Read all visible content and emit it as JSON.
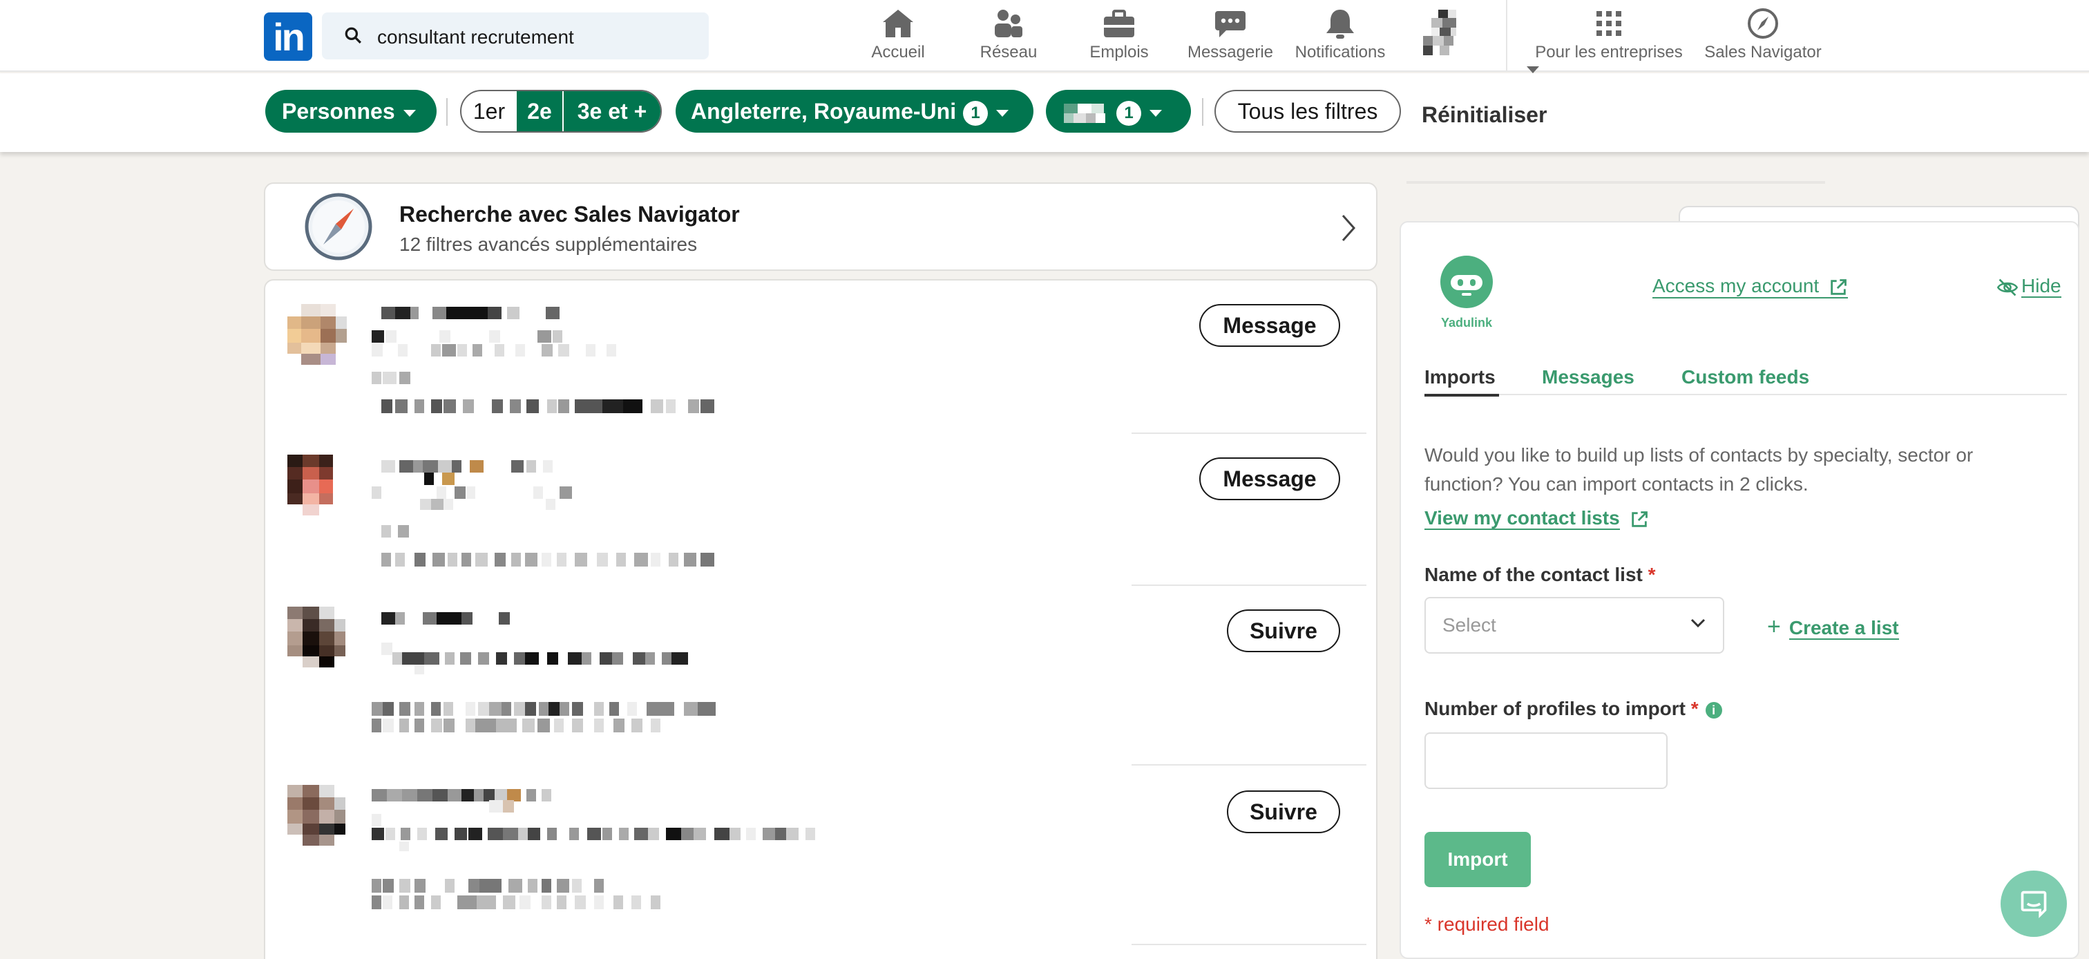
{
  "topnav": {
    "logo_text": "in",
    "search_value": "consultant recrutement",
    "items": [
      {
        "label": "Accueil",
        "icon": "home-icon"
      },
      {
        "label": "Réseau",
        "icon": "network-icon"
      },
      {
        "label": "Emplois",
        "icon": "briefcase-icon"
      },
      {
        "label": "Messagerie",
        "icon": "chat-icon"
      },
      {
        "label": "Notifications",
        "icon": "bell-icon"
      }
    ],
    "business_label": "Pour les entreprises",
    "sales_nav_label": "Sales Navigator"
  },
  "filters": {
    "people_label": "Personnes",
    "degree_1": "1er",
    "degree_2": "2e",
    "degree_3": "3e et +",
    "location_label": "Angleterre, Royaume-Uni",
    "location_count": "1",
    "company_count": "1",
    "all_filters_label": "Tous les filtres",
    "reset_label": "Réinitialiser"
  },
  "sales_navigator_card": {
    "title": "Recherche avec Sales Navigator",
    "subtitle": "12 filtres avancés supplémentaires"
  },
  "results": [
    {
      "action": "Message"
    },
    {
      "action": "Message"
    },
    {
      "action": "Suivre"
    },
    {
      "action": "Suivre"
    }
  ],
  "yadulink": {
    "brand": "Yadulink",
    "access_label": "Access my account",
    "hide_label": "Hide",
    "tabs": [
      "Imports",
      "Messages",
      "Custom feeds"
    ],
    "description": "Would you like to build up lists of contacts by specialty, sector or function? You can import contacts in 2 clicks.",
    "view_lists_label": "View my contact lists",
    "list_name_label": "Name of the contact list",
    "select_placeholder": "Select",
    "create_list_label": "Create a list",
    "profiles_label": "Number of profiles to import",
    "required_mark": "*",
    "import_label": "Import",
    "required_note": "* required field",
    "colors": {
      "accent": "#3a9a6e",
      "button": "#5cb98a",
      "required": "#d9362b"
    }
  },
  "colors": {
    "linkedin_blue": "#0a66c2",
    "filter_green": "#01754f"
  }
}
